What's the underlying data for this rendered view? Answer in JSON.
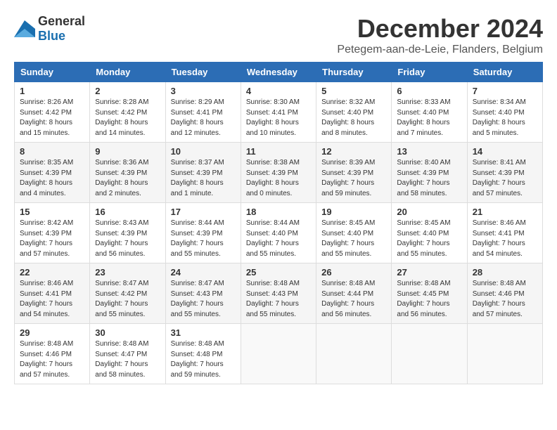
{
  "logo": {
    "general": "General",
    "blue": "Blue"
  },
  "title": "December 2024",
  "subtitle": "Petegem-aan-de-Leie, Flanders, Belgium",
  "headers": [
    "Sunday",
    "Monday",
    "Tuesday",
    "Wednesday",
    "Thursday",
    "Friday",
    "Saturday"
  ],
  "weeks": [
    [
      {
        "day": "1",
        "sunrise": "Sunrise: 8:26 AM",
        "sunset": "Sunset: 4:42 PM",
        "daylight": "Daylight: 8 hours and 15 minutes."
      },
      {
        "day": "2",
        "sunrise": "Sunrise: 8:28 AM",
        "sunset": "Sunset: 4:42 PM",
        "daylight": "Daylight: 8 hours and 14 minutes."
      },
      {
        "day": "3",
        "sunrise": "Sunrise: 8:29 AM",
        "sunset": "Sunset: 4:41 PM",
        "daylight": "Daylight: 8 hours and 12 minutes."
      },
      {
        "day": "4",
        "sunrise": "Sunrise: 8:30 AM",
        "sunset": "Sunset: 4:41 PM",
        "daylight": "Daylight: 8 hours and 10 minutes."
      },
      {
        "day": "5",
        "sunrise": "Sunrise: 8:32 AM",
        "sunset": "Sunset: 4:40 PM",
        "daylight": "Daylight: 8 hours and 8 minutes."
      },
      {
        "day": "6",
        "sunrise": "Sunrise: 8:33 AM",
        "sunset": "Sunset: 4:40 PM",
        "daylight": "Daylight: 8 hours and 7 minutes."
      },
      {
        "day": "7",
        "sunrise": "Sunrise: 8:34 AM",
        "sunset": "Sunset: 4:40 PM",
        "daylight": "Daylight: 8 hours and 5 minutes."
      }
    ],
    [
      {
        "day": "8",
        "sunrise": "Sunrise: 8:35 AM",
        "sunset": "Sunset: 4:39 PM",
        "daylight": "Daylight: 8 hours and 4 minutes."
      },
      {
        "day": "9",
        "sunrise": "Sunrise: 8:36 AM",
        "sunset": "Sunset: 4:39 PM",
        "daylight": "Daylight: 8 hours and 2 minutes."
      },
      {
        "day": "10",
        "sunrise": "Sunrise: 8:37 AM",
        "sunset": "Sunset: 4:39 PM",
        "daylight": "Daylight: 8 hours and 1 minute."
      },
      {
        "day": "11",
        "sunrise": "Sunrise: 8:38 AM",
        "sunset": "Sunset: 4:39 PM",
        "daylight": "Daylight: 8 hours and 0 minutes."
      },
      {
        "day": "12",
        "sunrise": "Sunrise: 8:39 AM",
        "sunset": "Sunset: 4:39 PM",
        "daylight": "Daylight: 7 hours and 59 minutes."
      },
      {
        "day": "13",
        "sunrise": "Sunrise: 8:40 AM",
        "sunset": "Sunset: 4:39 PM",
        "daylight": "Daylight: 7 hours and 58 minutes."
      },
      {
        "day": "14",
        "sunrise": "Sunrise: 8:41 AM",
        "sunset": "Sunset: 4:39 PM",
        "daylight": "Daylight: 7 hours and 57 minutes."
      }
    ],
    [
      {
        "day": "15",
        "sunrise": "Sunrise: 8:42 AM",
        "sunset": "Sunset: 4:39 PM",
        "daylight": "Daylight: 7 hours and 57 minutes."
      },
      {
        "day": "16",
        "sunrise": "Sunrise: 8:43 AM",
        "sunset": "Sunset: 4:39 PM",
        "daylight": "Daylight: 7 hours and 56 minutes."
      },
      {
        "day": "17",
        "sunrise": "Sunrise: 8:44 AM",
        "sunset": "Sunset: 4:39 PM",
        "daylight": "Daylight: 7 hours and 55 minutes."
      },
      {
        "day": "18",
        "sunrise": "Sunrise: 8:44 AM",
        "sunset": "Sunset: 4:40 PM",
        "daylight": "Daylight: 7 hours and 55 minutes."
      },
      {
        "day": "19",
        "sunrise": "Sunrise: 8:45 AM",
        "sunset": "Sunset: 4:40 PM",
        "daylight": "Daylight: 7 hours and 55 minutes."
      },
      {
        "day": "20",
        "sunrise": "Sunrise: 8:45 AM",
        "sunset": "Sunset: 4:40 PM",
        "daylight": "Daylight: 7 hours and 55 minutes."
      },
      {
        "day": "21",
        "sunrise": "Sunrise: 8:46 AM",
        "sunset": "Sunset: 4:41 PM",
        "daylight": "Daylight: 7 hours and 54 minutes."
      }
    ],
    [
      {
        "day": "22",
        "sunrise": "Sunrise: 8:46 AM",
        "sunset": "Sunset: 4:41 PM",
        "daylight": "Daylight: 7 hours and 54 minutes."
      },
      {
        "day": "23",
        "sunrise": "Sunrise: 8:47 AM",
        "sunset": "Sunset: 4:42 PM",
        "daylight": "Daylight: 7 hours and 55 minutes."
      },
      {
        "day": "24",
        "sunrise": "Sunrise: 8:47 AM",
        "sunset": "Sunset: 4:43 PM",
        "daylight": "Daylight: 7 hours and 55 minutes."
      },
      {
        "day": "25",
        "sunrise": "Sunrise: 8:48 AM",
        "sunset": "Sunset: 4:43 PM",
        "daylight": "Daylight: 7 hours and 55 minutes."
      },
      {
        "day": "26",
        "sunrise": "Sunrise: 8:48 AM",
        "sunset": "Sunset: 4:44 PM",
        "daylight": "Daylight: 7 hours and 56 minutes."
      },
      {
        "day": "27",
        "sunrise": "Sunrise: 8:48 AM",
        "sunset": "Sunset: 4:45 PM",
        "daylight": "Daylight: 7 hours and 56 minutes."
      },
      {
        "day": "28",
        "sunrise": "Sunrise: 8:48 AM",
        "sunset": "Sunset: 4:46 PM",
        "daylight": "Daylight: 7 hours and 57 minutes."
      }
    ],
    [
      {
        "day": "29",
        "sunrise": "Sunrise: 8:48 AM",
        "sunset": "Sunset: 4:46 PM",
        "daylight": "Daylight: 7 hours and 57 minutes."
      },
      {
        "day": "30",
        "sunrise": "Sunrise: 8:48 AM",
        "sunset": "Sunset: 4:47 PM",
        "daylight": "Daylight: 7 hours and 58 minutes."
      },
      {
        "day": "31",
        "sunrise": "Sunrise: 8:48 AM",
        "sunset": "Sunset: 4:48 PM",
        "daylight": "Daylight: 7 hours and 59 minutes."
      },
      null,
      null,
      null,
      null
    ]
  ]
}
